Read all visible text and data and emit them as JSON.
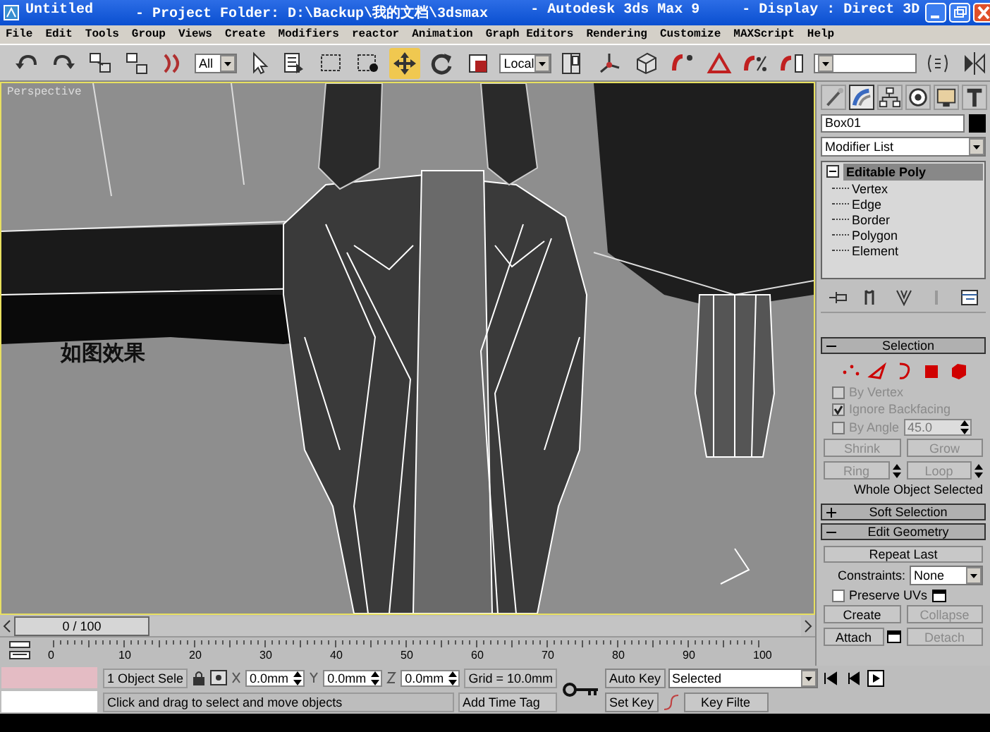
{
  "title_bar": {
    "texts": [
      "Untitled",
      "- Project Folder: D:\\Backup\\我的文档\\3dsmax",
      "- Autodesk 3ds Max 9",
      "- Display : Direct 3D"
    ]
  },
  "menu": [
    "File",
    "Edit",
    "Tools",
    "Group",
    "Views",
    "Create",
    "Modifiers",
    "reactor",
    "Animation",
    "Graph Editors",
    "Rendering",
    "Customize",
    "MAXScript",
    "Help"
  ],
  "toolbar": [
    {
      "kind": "tool",
      "selected": false
    },
    {
      "kind": "tool",
      "selected": false
    },
    {
      "kind": "tool",
      "selected": false
    },
    {
      "kind": "tool",
      "selected": false
    },
    {
      "kind": "tool",
      "selected": false
    },
    {
      "kind": "dropdown",
      "value": "All"
    },
    {
      "kind": "tool",
      "selected": false
    },
    {
      "kind": "tool",
      "selected": false
    },
    {
      "kind": "tool",
      "selected": false
    },
    {
      "kind": "tool",
      "selected": false
    },
    {
      "kind": "tool",
      "selected": true
    },
    {
      "kind": "tool",
      "selected": false
    },
    {
      "kind": "tool",
      "selected": false
    },
    {
      "kind": "dropdown",
      "value": "Local"
    },
    {
      "kind": "tool",
      "selected": false
    },
    {
      "kind": "tool",
      "selected": false
    },
    {
      "kind": "tool",
      "selected": false
    },
    {
      "kind": "tool",
      "selected": false
    },
    {
      "kind": "tool",
      "selected": false
    },
    {
      "kind": "tool",
      "selected": false
    },
    {
      "kind": "tool",
      "selected": false
    },
    {
      "kind": "dropdown"
    },
    {
      "kind": "tool",
      "selected": false
    },
    {
      "kind": "tool",
      "selected": false
    }
  ],
  "viewport": {
    "label": "Perspective",
    "caption": "如图效果"
  },
  "command_panel": {
    "tabs": [
      {
        "selected": false
      },
      {
        "selected": true
      },
      {
        "selected": false
      },
      {
        "selected": false
      },
      {
        "selected": false
      },
      {
        "selected": false
      }
    ],
    "object_name": "Box01",
    "modifier_list": "Modifier List",
    "stack": {
      "label": "Editable Poly",
      "expanded": true,
      "selected": true,
      "children": [
        {
          "label": "Vertex"
        },
        {
          "label": "Edge"
        },
        {
          "label": "Border"
        },
        {
          "label": "Polygon"
        },
        {
          "label": "Element"
        }
      ]
    },
    "rollouts": [
      {
        "title": "Selection",
        "expanded": true,
        "kind": "selection",
        "levels": [
          {
            "selected": false
          },
          {
            "selected": false
          },
          {
            "selected": false
          },
          {
            "selected": false
          },
          {
            "selected": false
          }
        ],
        "checks": [
          {
            "label": "By Vertex",
            "checked": false,
            "disabled": true
          },
          {
            "label": "Ignore Backfacing",
            "checked": true,
            "disabled": true
          },
          {
            "label": "By Angle",
            "checked": false,
            "disabled": true,
            "value": "45.0"
          }
        ],
        "buttons": [
          {
            "label": "Shrink",
            "disabled": true,
            "spinner": false
          },
          {
            "label": "Grow",
            "disabled": true,
            "spinner": false
          },
          {
            "label": "Ring",
            "disabled": true,
            "spinner": true
          },
          {
            "label": "Loop",
            "disabled": true,
            "spinner": true
          }
        ],
        "status": "Whole Object Selected"
      },
      {
        "title": "Soft Selection",
        "expanded": false
      },
      {
        "title": "Edit Geometry",
        "expanded": true,
        "kind": "geometry",
        "repeat": "Repeat Last",
        "constraints_label": "Constraints:",
        "constraints_value": "None",
        "preserve": {
          "label": "Preserve UVs",
          "checked": false
        },
        "buttons": [
          {
            "label": "Create",
            "disabled": false,
            "settings": false
          },
          {
            "label": "Collapse",
            "disabled": true,
            "settings": false
          },
          {
            "label": "Attach",
            "disabled": false,
            "settings": true
          },
          {
            "label": "Detach",
            "disabled": true,
            "settings": false
          }
        ]
      }
    ]
  },
  "time_slider": {
    "label": "0 / 100",
    "level": 0
  },
  "track_bar": {
    "labels": [
      "0",
      "10",
      "20",
      "30",
      "40",
      "50",
      "60",
      "70",
      "80",
      "90",
      "100"
    ]
  },
  "status_bar": {
    "selection": "1 Object Sele",
    "x": "0.0mm",
    "y": "0.0mm",
    "z": "0.0mm",
    "grid": "Grid = 10.0mm",
    "prompt": "Click and drag to select and move objects",
    "time_tag": "Add Time Tag",
    "auto_key": "Auto Key",
    "set_key": "Set Key",
    "key_mode": "Selected",
    "key_filters": "Key Filte"
  }
}
